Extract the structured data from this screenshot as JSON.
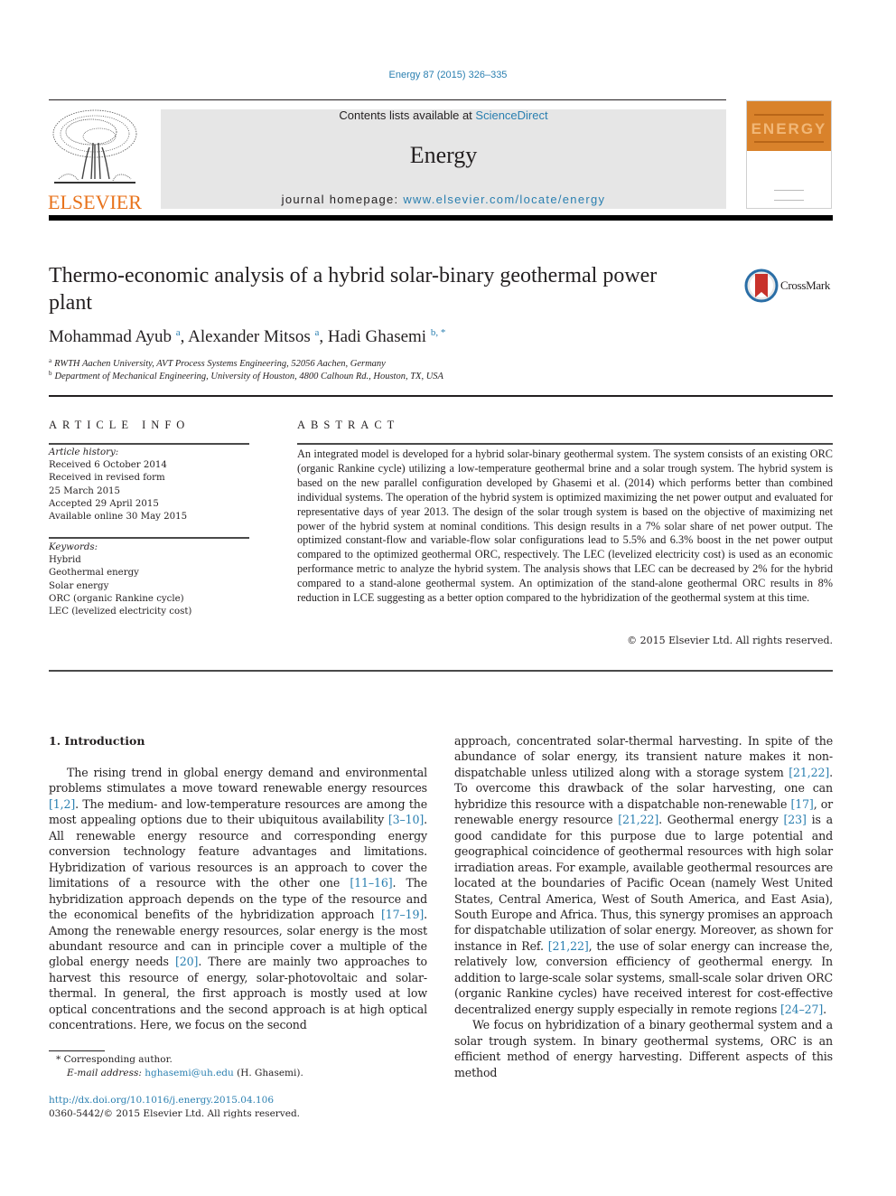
{
  "header": {
    "journal_ref": "Energy 87 (2015) 326–335",
    "contents_prefix": "Contents lists available at ",
    "contents_link": "ScienceDirect",
    "journal_name": "Energy",
    "homepage_prefix": "journal homepage: ",
    "homepage_link": "www.elsevier.com/locate/energy",
    "publisher_logo": "ELSEVIER",
    "cover_title": "ENERGY",
    "brand_colors": {
      "link": "#2a7fb0",
      "elsevier_orange": "#e8731c",
      "cover_orange": "#d9822b"
    }
  },
  "article": {
    "title": "Thermo-economic analysis of a hybrid solar-binary geothermal power plant",
    "crossmark_label": "CrossMark",
    "authors": [
      {
        "name": "Mohammad Ayub",
        "sup": "a"
      },
      {
        "name": "Alexander Mitsos",
        "sup": "a"
      },
      {
        "name": "Hadi Ghasemi",
        "sup": "b, *"
      }
    ],
    "affiliations": [
      {
        "sup": "a",
        "text": "RWTH Aachen University, AVT Process Systems Engineering, 52056 Aachen, Germany"
      },
      {
        "sup": "b",
        "text": "Department of Mechanical Engineering, University of Houston, 4800 Calhoun Rd., Houston, TX, USA"
      }
    ]
  },
  "article_info": {
    "label": "ARTICLE INFO",
    "history_heading": "Article history:",
    "history": [
      "Received 6 October 2014",
      "Received in revised form",
      "25 March 2015",
      "Accepted 29 April 2015",
      "Available online 30 May 2015"
    ],
    "keywords_heading": "Keywords:",
    "keywords": [
      "Hybrid",
      "Geothermal energy",
      "Solar energy",
      "ORC (organic Rankine cycle)",
      "LEC (levelized electricity cost)"
    ]
  },
  "abstract": {
    "label": "ABSTRACT",
    "text": "An integrated model is developed for a hybrid solar-binary geothermal system. The system consists of an existing ORC (organic Rankine cycle) utilizing a low-temperature geothermal brine and a solar trough system. The hybrid system is based on the new parallel configuration developed by Ghasemi et al. (2014) which performs better than combined individual systems. The operation of the hybrid system is optimized maximizing the net power output and evaluated for representative days of year 2013. The design of the solar trough system is based on the objective of maximizing net power of the hybrid system at nominal conditions. This design results in a 7% solar share of net power output. The optimized constant-flow and variable-flow solar configurations lead to 5.5% and 6.3% boost in the net power output compared to the optimized geothermal ORC, respectively. The LEC (levelized electricity cost) is used as an economic performance metric to analyze the hybrid system. The analysis shows that LEC can be decreased by 2% for the hybrid compared to a stand-alone geothermal system. An optimization of the stand-alone geothermal ORC results in 8% reduction in LCE suggesting as a better option compared to the hybridization of the geothermal system at this time.",
    "copyright": "© 2015 Elsevier Ltd. All rights reserved."
  },
  "introduction": {
    "heading": "1.  Introduction",
    "left_column": [
      [
        "The rising trend in global energy demand and environmental problems stimulates a move toward renewable energy resources ",
        "[1,2]",
        ". The medium- and low-temperature resources are among the most appealing options due to their ubiquitous availability ",
        "[3–10]",
        ". All renewable energy resource and corresponding energy conversion technology feature advantages and limitations. Hybridization of various resources is an approach to cover the limitations of a resource with the other one ",
        "[11–16]",
        ". The hybridization approach depends on the type of the resource and the economical benefits of the hybridization approach ",
        "[17–19]",
        ". Among the renewable energy resources, solar energy is the most abundant resource and can in principle cover a multiple of the global energy needs ",
        "[20]",
        ". There are mainly two approaches to harvest this resource of energy, solar-photovoltaic and solar-thermal. In general, the first approach is mostly used at low optical concentrations and the second approach is at high optical concentrations. Here, we focus on the second"
      ]
    ],
    "right_column": [
      [
        "approach, concentrated solar-thermal harvesting. In spite of the abundance of solar energy, its transient nature makes it non-dispatchable unless utilized along with a storage system ",
        "[21,22]",
        ". To overcome this drawback of the solar harvesting, one can hybridize this resource with a dispatchable non-renewable ",
        "[17]",
        ", or renewable energy resource ",
        "[21,22]",
        ". Geothermal energy ",
        "[23]",
        " is a good candidate for this purpose due to large potential and geographical coincidence of geothermal resources with high solar irradiation areas. For example, available geothermal resources are located at the boundaries of Pacific Ocean (namely West United States, Central America, West of South America, and East Asia), South Europe and Africa. Thus, this synergy promises an approach for dispatchable utilization of solar energy. Moreover, as shown for instance in Ref. ",
        "[21,22]",
        ", the use of solar energy can increase the, relatively low, conversion efficiency of geothermal energy. In addition to large-scale solar systems, small-scale solar driven ORC (organic Rankine cycles) have received interest for cost-effective decentralized energy supply especially in remote regions ",
        "[24–27]",
        "."
      ],
      [
        "We focus on hybridization of a binary geothermal system and a solar trough system. In binary geothermal systems, ORC is an efficient method of energy harvesting. Different aspects of this method"
      ]
    ]
  },
  "footnote": {
    "corresponding": "* Corresponding author.",
    "email_label": "E-mail address:",
    "email": "hghasemi@uh.edu",
    "email_suffix": " (H. Ghasemi).",
    "doi": "http://dx.doi.org/10.1016/j.energy.2015.04.106",
    "issn": "0360-5442/© 2015 Elsevier Ltd. All rights reserved."
  }
}
